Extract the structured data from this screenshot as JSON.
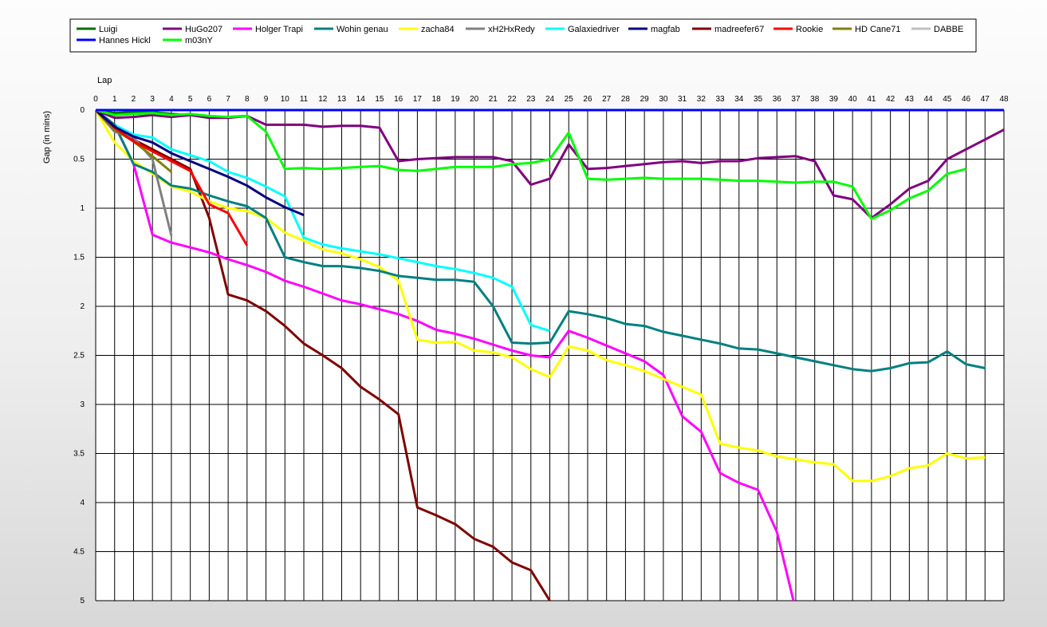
{
  "chart_data": {
    "type": "line",
    "title": "",
    "xlabel": "Lap",
    "ylabel": "Gap (in mins)",
    "xlim": [
      0,
      48
    ],
    "ylim": [
      0,
      5
    ],
    "y_inverted": true,
    "xticks": [
      0,
      1,
      2,
      3,
      4,
      5,
      6,
      7,
      8,
      9,
      10,
      11,
      12,
      13,
      14,
      15,
      16,
      17,
      18,
      19,
      20,
      21,
      22,
      23,
      24,
      25,
      26,
      27,
      28,
      29,
      30,
      31,
      32,
      33,
      34,
      35,
      36,
      37,
      38,
      39,
      40,
      41,
      42,
      43,
      44,
      45,
      46,
      47,
      48
    ],
    "yticks": [
      0,
      0.5,
      1,
      1.5,
      2,
      2.5,
      3,
      3.5,
      4,
      4.5,
      5
    ],
    "grid": true,
    "legend_position": "top",
    "series": [
      {
        "name": "Luigi",
        "color": "#007000",
        "x": [
          0,
          1,
          2,
          3,
          4,
          5,
          6,
          7,
          8
        ],
        "y": [
          0,
          0.03,
          0.02,
          0.02,
          0.04,
          0.05,
          0.07,
          0.07,
          0.06
        ]
      },
      {
        "name": "HuGo207",
        "color": "#800080",
        "x": [
          0,
          1,
          2,
          3,
          4,
          5,
          6,
          7,
          8,
          9,
          10,
          11,
          12,
          13,
          14,
          15,
          16,
          17,
          18,
          19,
          20,
          21,
          22,
          23,
          24,
          25,
          26,
          27,
          28,
          29,
          30,
          31,
          32,
          33,
          34,
          35,
          36,
          37,
          38,
          39,
          40,
          41,
          42,
          43,
          44,
          45,
          46,
          47,
          48
        ],
        "y": [
          0,
          0.08,
          0.07,
          0.05,
          0.07,
          0.05,
          0.08,
          0.08,
          0.06,
          0.15,
          0.15,
          0.15,
          0.17,
          0.16,
          0.16,
          0.18,
          0.52,
          0.5,
          0.49,
          0.48,
          0.48,
          0.48,
          0.52,
          0.76,
          0.7,
          0.35,
          0.6,
          0.59,
          0.57,
          0.55,
          0.53,
          0.52,
          0.54,
          0.52,
          0.52,
          0.49,
          0.48,
          0.47,
          0.52,
          0.87,
          0.91,
          1.1,
          0.96,
          0.8,
          0.72,
          0.5,
          0.4,
          0.3,
          0.2
        ]
      },
      {
        "name": "Holger Trapi",
        "color": "#ff00ff",
        "x": [
          0,
          1,
          2,
          3,
          4,
          5,
          6,
          7,
          8,
          9,
          10,
          11,
          12,
          13,
          14,
          15,
          16,
          17,
          18,
          19,
          20,
          21,
          22,
          23,
          24,
          25,
          26,
          27,
          28,
          29,
          30,
          31,
          32,
          33,
          34,
          35,
          36,
          37
        ],
        "y": [
          0,
          0.15,
          0.55,
          1.27,
          1.35,
          1.4,
          1.45,
          1.52,
          1.58,
          1.65,
          1.74,
          1.8,
          1.87,
          1.94,
          1.98,
          2.03,
          2.08,
          2.15,
          2.24,
          2.28,
          2.33,
          2.39,
          2.45,
          2.5,
          2.52,
          2.25,
          2.32,
          2.4,
          2.48,
          2.56,
          2.7,
          3.12,
          3.28,
          3.7,
          3.8,
          3.87,
          4.3,
          5.1
        ]
      },
      {
        "name": "Wohin genau",
        "color": "#008080",
        "x": [
          0,
          1,
          2,
          3,
          4,
          5,
          6,
          7,
          8,
          9,
          10,
          11,
          12,
          13,
          14,
          15,
          16,
          17,
          18,
          19,
          20,
          21,
          22,
          23,
          24,
          25,
          26,
          27,
          28,
          29,
          30,
          31,
          32,
          33,
          34,
          35,
          36,
          37,
          38,
          39,
          40,
          41,
          42,
          43,
          44,
          45,
          46,
          47
        ],
        "y": [
          0,
          0.15,
          0.55,
          0.63,
          0.77,
          0.8,
          0.87,
          0.93,
          0.98,
          1.1,
          1.5,
          1.55,
          1.59,
          1.59,
          1.61,
          1.64,
          1.69,
          1.71,
          1.73,
          1.73,
          1.75,
          2.0,
          2.37,
          2.38,
          2.37,
          2.05,
          2.08,
          2.12,
          2.18,
          2.2,
          2.26,
          2.3,
          2.34,
          2.38,
          2.43,
          2.44,
          2.48,
          2.52,
          2.56,
          2.6,
          2.64,
          2.66,
          2.63,
          2.58,
          2.57,
          2.46,
          2.59,
          2.63
        ]
      },
      {
        "name": "zacha84",
        "color": "#ffff00",
        "x": [
          0,
          1,
          2,
          3,
          4,
          5,
          6,
          7,
          8,
          9,
          10,
          11,
          12,
          13,
          14,
          15,
          16,
          17,
          18,
          19,
          20,
          21,
          22,
          23,
          24,
          25,
          26,
          27,
          28,
          29,
          30,
          31,
          32,
          33,
          34,
          35,
          36,
          37,
          38,
          39,
          40,
          41,
          42,
          43,
          44,
          45,
          46,
          47
        ],
        "y": [
          0,
          0.33,
          0.52,
          0.65,
          0.78,
          0.83,
          0.93,
          1.0,
          1.03,
          1.1,
          1.25,
          1.33,
          1.42,
          1.46,
          1.52,
          1.6,
          1.74,
          2.34,
          2.37,
          2.36,
          2.45,
          2.47,
          2.52,
          2.64,
          2.72,
          2.41,
          2.45,
          2.55,
          2.6,
          2.66,
          2.74,
          2.82,
          2.9,
          3.4,
          3.44,
          3.47,
          3.53,
          3.56,
          3.59,
          3.61,
          3.78,
          3.78,
          3.73,
          3.65,
          3.62,
          3.5,
          3.55,
          3.54
        ]
      },
      {
        "name": "xH2HxRedy",
        "color": "#808080",
        "x": [
          0,
          1,
          2,
          3,
          4
        ],
        "y": [
          0,
          0.22,
          0.28,
          0.5,
          1.28
        ]
      },
      {
        "name": "Galaxiedriver",
        "color": "#00ffff",
        "x": [
          0,
          1,
          2,
          3,
          4,
          5,
          6,
          7,
          8,
          9,
          10,
          11,
          12,
          13,
          14,
          15,
          16,
          17,
          18,
          19,
          20,
          21,
          22,
          23,
          24
        ],
        "y": [
          0,
          0.15,
          0.25,
          0.28,
          0.4,
          0.46,
          0.52,
          0.63,
          0.69,
          0.78,
          0.88,
          1.3,
          1.37,
          1.41,
          1.44,
          1.47,
          1.51,
          1.55,
          1.59,
          1.62,
          1.66,
          1.71,
          1.8,
          2.19,
          2.25
        ]
      },
      {
        "name": "magfab",
        "color": "#000080",
        "x": [
          0,
          1,
          2,
          3,
          4,
          5,
          6,
          7,
          8,
          9,
          10,
          11
        ],
        "y": [
          0,
          0.17,
          0.27,
          0.33,
          0.44,
          0.52,
          0.6,
          0.68,
          0.77,
          0.89,
          0.99,
          1.07
        ]
      },
      {
        "name": "madreefer67",
        "color": "#800000",
        "x": [
          0,
          1,
          2,
          3,
          4,
          5,
          6,
          7,
          8,
          9,
          10,
          11,
          12,
          13,
          14,
          15,
          16,
          17,
          18,
          19,
          20,
          21,
          22,
          23,
          24,
          25
        ],
        "y": [
          0,
          0.17,
          0.3,
          0.4,
          0.5,
          0.6,
          1.1,
          1.88,
          1.94,
          2.05,
          2.2,
          2.38,
          2.5,
          2.63,
          2.82,
          2.95,
          3.1,
          4.05,
          4.13,
          4.22,
          4.37,
          4.45,
          4.61,
          4.69,
          5.0,
          5.4
        ]
      },
      {
        "name": "Rookie",
        "color": "#ff0000",
        "x": [
          0,
          1,
          2,
          3,
          4,
          5,
          6,
          7,
          8
        ],
        "y": [
          0,
          0.18,
          0.32,
          0.42,
          0.52,
          0.62,
          0.96,
          1.05,
          1.38
        ]
      },
      {
        "name": "HD Cane71",
        "color": "#808000",
        "x": [
          0,
          1,
          2,
          3,
          4
        ],
        "y": [
          0,
          0.2,
          0.32,
          0.47,
          0.63
        ]
      },
      {
        "name": "DABBE",
        "color": "#c0c0c0",
        "x": [],
        "y": []
      },
      {
        "name": "Hannes Hickl",
        "color": "#0000ff",
        "x": [
          0,
          1,
          2,
          3,
          4,
          5,
          6,
          7,
          8,
          9,
          10,
          11,
          12,
          13,
          14,
          15,
          16,
          17,
          18,
          19,
          20,
          21,
          22,
          23,
          24,
          25,
          26,
          27,
          28,
          29,
          30,
          31,
          32,
          33,
          34,
          35,
          36,
          37,
          38,
          39,
          40,
          41,
          42,
          43,
          44,
          45,
          46,
          47,
          48
        ],
        "y": [
          0,
          0,
          0,
          0,
          0,
          0,
          0,
          0,
          0,
          0,
          0,
          0,
          0,
          0,
          0,
          0,
          0,
          0,
          0,
          0,
          0,
          0,
          0,
          0,
          0,
          0,
          0,
          0,
          0,
          0,
          0,
          0,
          0,
          0,
          0,
          0,
          0,
          0,
          0,
          0,
          0,
          0,
          0,
          0,
          0,
          0,
          0,
          0,
          0
        ]
      },
      {
        "name": "m03nY",
        "color": "#00ff00",
        "x": [
          0,
          1,
          2,
          3,
          4,
          5,
          6,
          7,
          8,
          9,
          10,
          11,
          12,
          13,
          14,
          15,
          16,
          17,
          18,
          19,
          20,
          21,
          22,
          23,
          24,
          25,
          26,
          27,
          28,
          29,
          30,
          31,
          32,
          33,
          34,
          35,
          36,
          37,
          38,
          39,
          40,
          41,
          42,
          43,
          44,
          45,
          46
        ],
        "y": [
          0,
          0.05,
          0.04,
          0.03,
          0.05,
          0.04,
          0.06,
          0.07,
          0.06,
          0.22,
          0.6,
          0.59,
          0.6,
          0.59,
          0.58,
          0.57,
          0.61,
          0.62,
          0.6,
          0.58,
          0.58,
          0.58,
          0.55,
          0.54,
          0.5,
          0.23,
          0.7,
          0.71,
          0.7,
          0.69,
          0.7,
          0.7,
          0.7,
          0.71,
          0.72,
          0.72,
          0.73,
          0.74,
          0.73,
          0.73,
          0.78,
          1.11,
          1.02,
          0.9,
          0.82,
          0.65,
          0.6
        ]
      }
    ]
  }
}
